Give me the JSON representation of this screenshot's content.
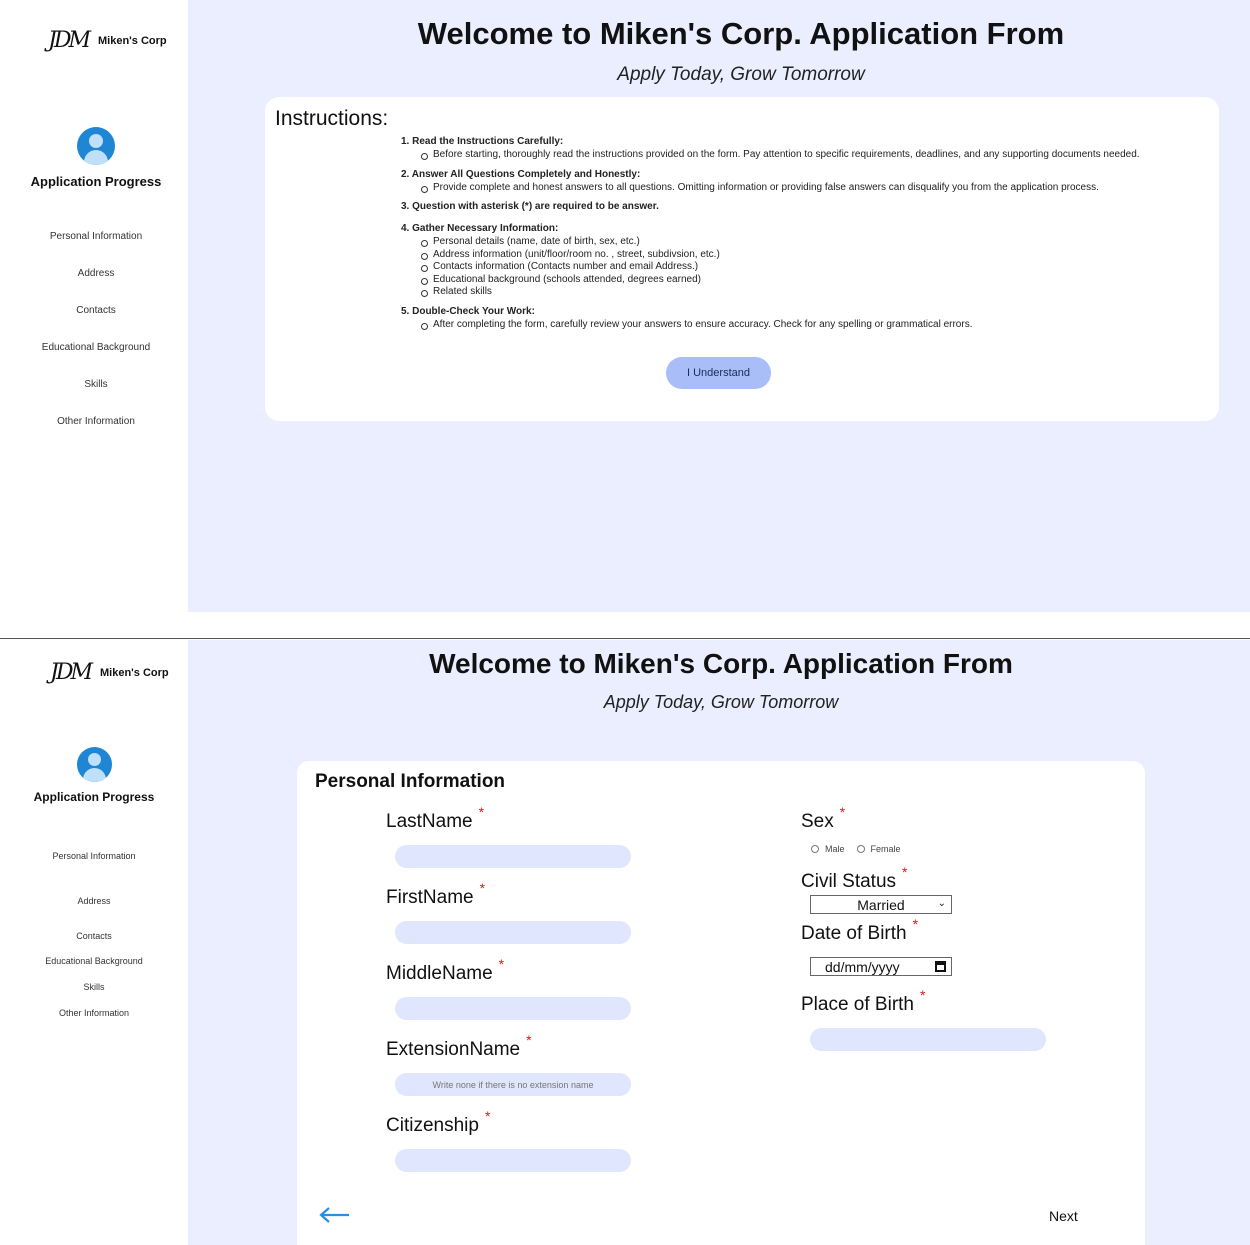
{
  "brand": {
    "logo_mark": "JDM",
    "name": "Miken's Corp"
  },
  "sidebar": {
    "progress_title": "Application Progress",
    "items": [
      {
        "label": "Personal Information"
      },
      {
        "label": "Address"
      },
      {
        "label": "Contacts"
      },
      {
        "label": "Educational Background"
      },
      {
        "label": "Skills"
      },
      {
        "label": "Other Information"
      }
    ]
  },
  "header": {
    "title": "Welcome to Miken's Corp. Application From",
    "subtitle": "Apply Today, Grow Tomorrow"
  },
  "instructions": {
    "title": "Instructions:",
    "steps": [
      {
        "heading": "1. Read the Instructions Carefully:",
        "bullets": [
          "Before starting, thoroughly read the instructions provided on the form. Pay attention to specific requirements, deadlines, and any supporting documents needed."
        ]
      },
      {
        "heading": "2. Answer All Questions Completely and Honestly:",
        "bullets": [
          "Provide complete and honest answers to all questions. Omitting information or providing false answers can disqualify you from the application process."
        ]
      },
      {
        "heading": "3. Question with asterisk (*) are required to be answer.",
        "bullets": []
      },
      {
        "heading": "4. Gather Necessary Information:",
        "bullets": [
          "Personal details (name, date of birth, sex, etc.)",
          "Address information (unit/floor/room no. , street, subdivsion, etc.)",
          "Contacts information (Contacts number and email Address.)",
          "Educational background (schools attended, degrees earned)",
          "Related skills"
        ]
      },
      {
        "heading": "5. Double-Check Your Work:",
        "bullets": [
          "After completing the form, carefully review your answers to ensure accuracy. Check for any spelling or grammatical errors."
        ]
      }
    ],
    "button_label": "I Understand"
  },
  "form": {
    "title": "Personal Information",
    "required_mark": "*",
    "fields": {
      "last_name": {
        "label": "LastName",
        "value": "",
        "placeholder": ""
      },
      "first_name": {
        "label": "FirstName",
        "value": "",
        "placeholder": ""
      },
      "middle_name": {
        "label": "MiddleName",
        "value": "",
        "placeholder": ""
      },
      "extension_name": {
        "label": "ExtensionName",
        "value": "",
        "placeholder": "Write none if there is no extension name"
      },
      "citizenship": {
        "label": "Citizenship",
        "value": "",
        "placeholder": ""
      },
      "sex": {
        "label": "Sex",
        "options": [
          "Male",
          "Female"
        ]
      },
      "civil_status": {
        "label": "Civil Status",
        "selected": "Married"
      },
      "date_of_birth": {
        "label": "Date of Birth",
        "placeholder": "dd/mm/yyyy"
      },
      "place_of_birth": {
        "label": "Place of Birth",
        "value": "",
        "placeholder": ""
      }
    },
    "next_label": "Next"
  },
  "icons": {
    "back": "arrow-left-icon",
    "calendar": "calendar-icon",
    "select": "chevron-down-icon",
    "avatar": "user-avatar-icon"
  },
  "colors": {
    "main_bg": "#eaeefe",
    "input_bg": "#dfe6fd",
    "button_bg": "#a9bdf9",
    "required": "#e0161b",
    "accent_blue": "#1f86d4"
  }
}
